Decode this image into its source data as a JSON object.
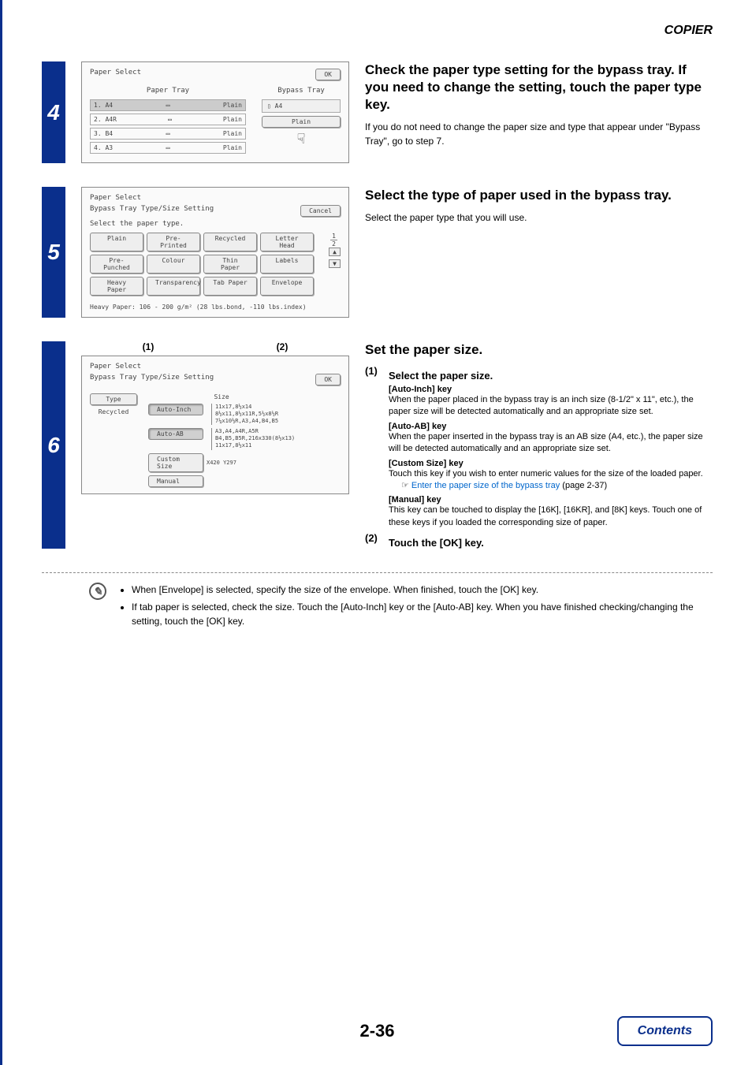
{
  "header": {
    "section": "COPIER"
  },
  "steps": {
    "s4": {
      "num": "4",
      "title": "Check the paper type setting for the bypass tray. If you need to change the setting, touch the paper type key.",
      "body": "If you do not need to change the paper size and type that appear under \"Bypass Tray\", go to step 7.",
      "panel": {
        "title": "Paper Select",
        "ok": "OK",
        "col1_title": "Paper Tray",
        "col2_title": "Bypass Tray",
        "trays": [
          {
            "label": "1. A4",
            "type": "Plain"
          },
          {
            "label": "2. A4R",
            "type": "Plain"
          },
          {
            "label": "3. B4",
            "type": "Plain"
          },
          {
            "label": "4. A3",
            "type": "Plain"
          }
        ],
        "bypass_size": "A4",
        "bypass_type": "Plain"
      }
    },
    "s5": {
      "num": "5",
      "title": "Select the type of paper used in the bypass tray.",
      "body": "Select the paper type that you will use.",
      "panel": {
        "title": "Paper Select",
        "subtitle": "Bypass Tray Type/Size Setting",
        "cancel": "Cancel",
        "prompt": "Select the paper type.",
        "page": "1",
        "pages": "2",
        "types": [
          "Plain",
          "Pre-Printed",
          "Recycled",
          "Letter Head",
          "Pre-Punched",
          "Colour",
          "Thin Paper",
          "Labels",
          "Heavy Paper",
          "Transparency",
          "Tab Paper",
          "Envelope"
        ],
        "note": "Heavy Paper: 106 - 200 g/m² (28 lbs.bond, -110 lbs.index)"
      }
    },
    "s6": {
      "num": "6",
      "title": "Set the paper size.",
      "callout1": "(1)",
      "callout2": "(2)",
      "item1": {
        "num": "(1)",
        "head": "Select the paper size.",
        "k1": "[Auto-Inch] key",
        "t1": "When the paper placed in the bypass tray is an inch size (8-1/2\" x 11\", etc.), the paper size will be detected automatically and an appropriate size set.",
        "k2": "[Auto-AB] key",
        "t2": "When the paper inserted in the bypass tray is an AB size (A4, etc.), the paper size will be detected automatically and an appropriate size set.",
        "k3": "[Custom Size] key",
        "t3": "Touch this key if you wish to enter numeric values for the size of the loaded paper.",
        "link": "Enter the paper size of the bypass tray",
        "linkref": " (page 2-37)",
        "k4": "[Manual] key",
        "t4": "This key can be touched to display the [16K], [16KR], and [8K] keys. Touch one of these keys if you loaded the corresponding size of paper."
      },
      "item2": {
        "num": "(2)",
        "head": "Touch the [OK] key."
      },
      "panel": {
        "title": "Paper Select",
        "subtitle": "Bypass Tray Type/Size Setting",
        "ok": "OK",
        "type_label": "Type",
        "type_value": "Recycled",
        "size_label": "Size",
        "btn_autoinch": "Auto-Inch",
        "btn_autoab": "Auto-AB",
        "btn_custom": "Custom Size",
        "btn_manual": "Manual",
        "list_inch": "11x17,8½x14\n8½x11,8½x11R,5½x8½R\n7¼x10½R,A3,A4,B4,B5",
        "list_ab": "A3,A4,A4R,A5R\nB4,B5,B5R,216x330(8½x13)\n11x17,8½x11",
        "list_custom": "X420 Y297"
      }
    }
  },
  "tips": {
    "b1": "When [Envelope] is selected, specify the size of the envelope. When finished, touch the [OK] key.",
    "b2": "If tab paper is selected, check the size. Touch the [Auto-Inch] key or the [Auto-AB] key. When you have finished checking/changing the setting, touch the [OK] key."
  },
  "footer": {
    "pagenum": "2-36",
    "contents": "Contents"
  }
}
